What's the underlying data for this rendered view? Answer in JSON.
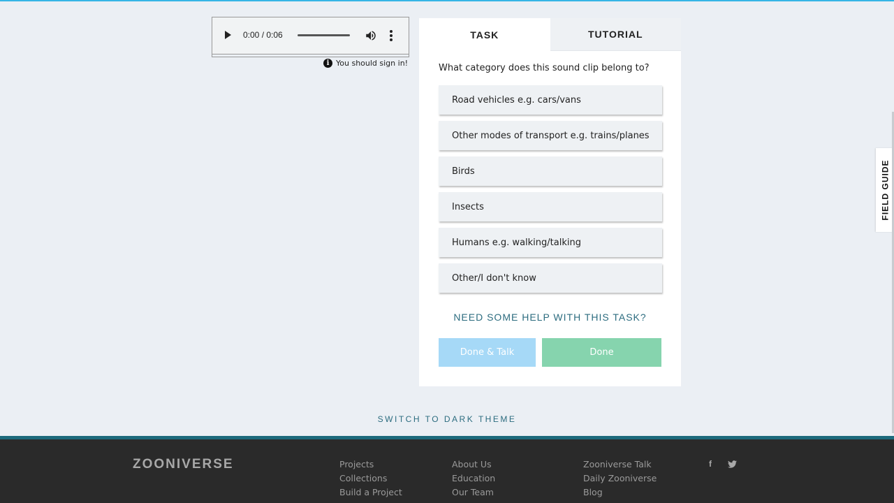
{
  "player": {
    "time": "0:00 / 0:06",
    "icons": [
      "play-icon",
      "volume-icon",
      "more-options-icon"
    ]
  },
  "signin": {
    "info_icon_glyph": "i",
    "message": "You should sign in!"
  },
  "task_panel": {
    "tabs": [
      {
        "label": "TASK"
      },
      {
        "label": "TUTORIAL"
      }
    ],
    "question": "What category does this sound clip belong to?",
    "answers": [
      {
        "label": "Road vehicles e.g. cars/vans"
      },
      {
        "label": "Other modes of transport e.g. trains/planes"
      },
      {
        "label": "Birds"
      },
      {
        "label": "Insects"
      },
      {
        "label": "Humans e.g. walking/talking"
      },
      {
        "label": "Other/I don't know"
      }
    ],
    "help_link": "NEED SOME HELP WITH THIS TASK?",
    "done_talk_label": "Done & Talk",
    "done_label": "Done"
  },
  "field_guide": {
    "label": "FIELD GUIDE"
  },
  "theme_switch": {
    "label": "SWITCH TO DARK THEME"
  },
  "footer": {
    "logo": "ZOONIVERSE",
    "col1": [
      "Projects",
      "Collections",
      "Build a Project"
    ],
    "col2": [
      "About Us",
      "Education",
      "Our Team"
    ],
    "col3": [
      "Zooniverse Talk",
      "Daily Zooniverse",
      "Blog"
    ],
    "social": {
      "facebook": "f",
      "twitter": "t"
    }
  },
  "colors": {
    "accent_teal": "#2c6c7f",
    "done_talk": "#a6d9f7",
    "done": "#86d4ae",
    "footer_bg": "#2a2a2a"
  }
}
